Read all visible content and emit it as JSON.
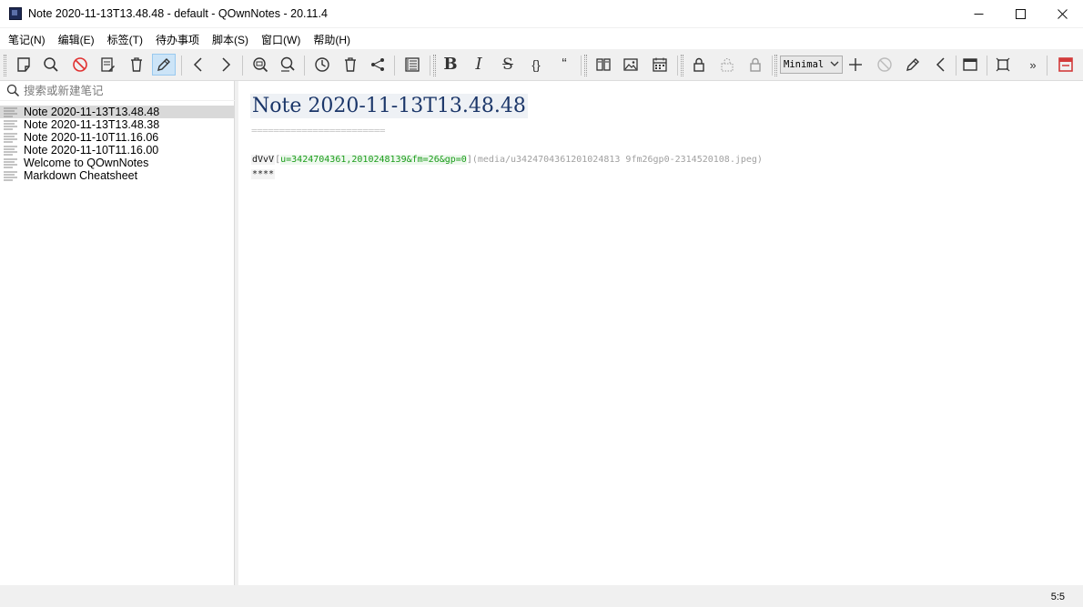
{
  "window": {
    "title": "Note 2020-11-13T13.48.48 - default - QOwnNotes - 20.11.4",
    "controls": {
      "minimize": "—",
      "maximize": "☐",
      "close": "✕"
    }
  },
  "menu": {
    "items": [
      {
        "label": "笔记(N)"
      },
      {
        "label": "编辑(E)"
      },
      {
        "label": "标签(T)"
      },
      {
        "label": "待办事项"
      },
      {
        "label": "脚本(S)"
      },
      {
        "label": "窗口(W)"
      },
      {
        "label": "帮助(H)"
      }
    ]
  },
  "toolbar": {
    "editor_mode": "Minimal",
    "overflow": "»",
    "buttons": {
      "bold": "B",
      "italic": "I",
      "strike": "S",
      "code": "{}",
      "quote": "“"
    }
  },
  "sidebar": {
    "search_placeholder": "搜索或新建笔记",
    "notes": [
      {
        "title": "Note 2020-11-13T13.48.48",
        "selected": true
      },
      {
        "title": "Note 2020-11-13T13.48.38",
        "selected": false
      },
      {
        "title": "Note 2020-11-10T11.16.06",
        "selected": false
      },
      {
        "title": "Note 2020-11-10T11.16.00",
        "selected": false
      },
      {
        "title": "Welcome to QOwnNotes",
        "selected": false
      },
      {
        "title": "Markdown Cheatsheet",
        "selected": false
      }
    ]
  },
  "editor": {
    "heading": "Note 2020-11-13T13.48.48",
    "heading_underline": "========================",
    "line_text": "dVvV",
    "link_open": "[",
    "link_text": "u=3424704361,2010248139&fm=26&gp=0",
    "link_close": "]",
    "link_url": "(media/u3424704361201024813 9fm26gp0-2314520108.jpeg)",
    "rule": "****"
  },
  "status": {
    "cursor": "5:5"
  },
  "colors": {
    "heading": "#1b3669",
    "link_text": "#1a9c1a",
    "selection": "#d9d9d9",
    "active_button": "#cce4f7"
  }
}
